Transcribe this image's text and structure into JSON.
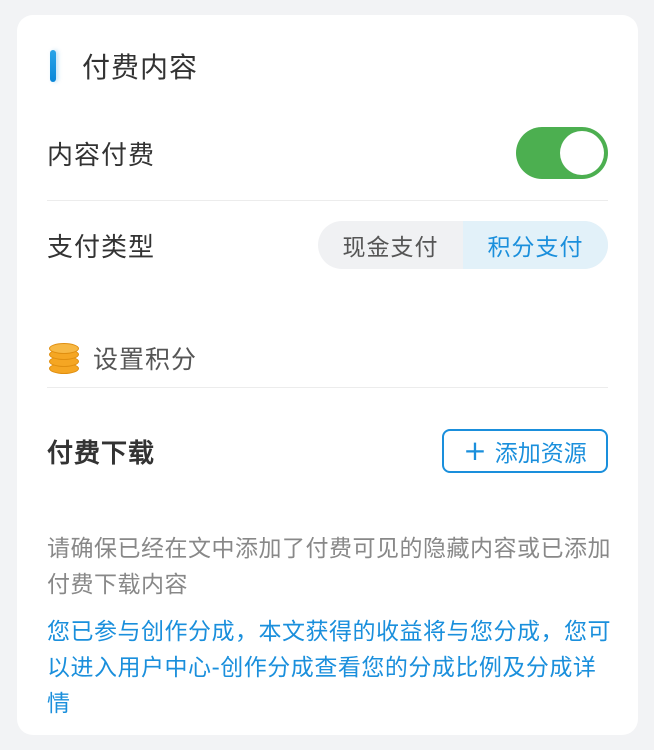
{
  "section": {
    "title": "付费内容"
  },
  "content_fee": {
    "label": "内容付费",
    "enabled": true
  },
  "pay_type": {
    "label": "支付类型",
    "options": [
      "现金支付",
      "积分支付"
    ],
    "selected": "积分支付"
  },
  "points": {
    "label": "设置积分"
  },
  "paid_download": {
    "label": "付费下载",
    "add_button": "添加资源"
  },
  "hint": "请确保已经在文中添加了付费可见的隐藏内容或已添加付费下载内容",
  "notice": {
    "before": "您已参与创作分成，本文获得的收益将与您分成，您可以进入",
    "link": "用户中心-创作分成",
    "after": "查看您的分成比例及分成详情"
  },
  "colors": {
    "accent": "#1a8fdc",
    "toggle_on": "#4caf50"
  }
}
